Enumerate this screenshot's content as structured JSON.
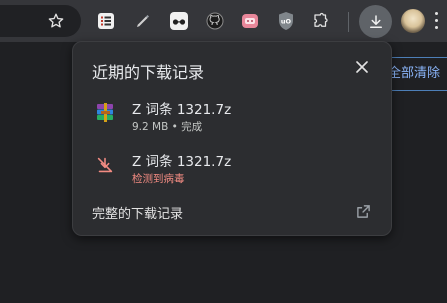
{
  "toolbar": {
    "icons": [
      "star-icon",
      "extension-list-icon",
      "pen-icon",
      "sunglasses-icon",
      "github-icon",
      "tab-manager-icon",
      "ublock-icon",
      "puzzle-icon",
      "download-icon",
      "avatar",
      "more-icon"
    ]
  },
  "page": {
    "clear_all_label": "全部清除"
  },
  "downloads_popup": {
    "title": "近期的下载记录",
    "items": [
      {
        "name": "Z 词条 1321.7z",
        "status": "9.2 MB • 完成",
        "icon": "winrar-archive-icon",
        "state": "complete"
      },
      {
        "name": "Z 词条 1321.7z",
        "status": "检测到病毒",
        "icon": "download-blocked-icon",
        "state": "danger"
      }
    ],
    "footer_link": "完整的下载记录"
  },
  "colors": {
    "toolbar_bg": "#35363a",
    "page_bg": "#1f2023",
    "popup_bg": "#2c2d30",
    "danger": "#f28b82",
    "link": "#8ab4f8"
  }
}
